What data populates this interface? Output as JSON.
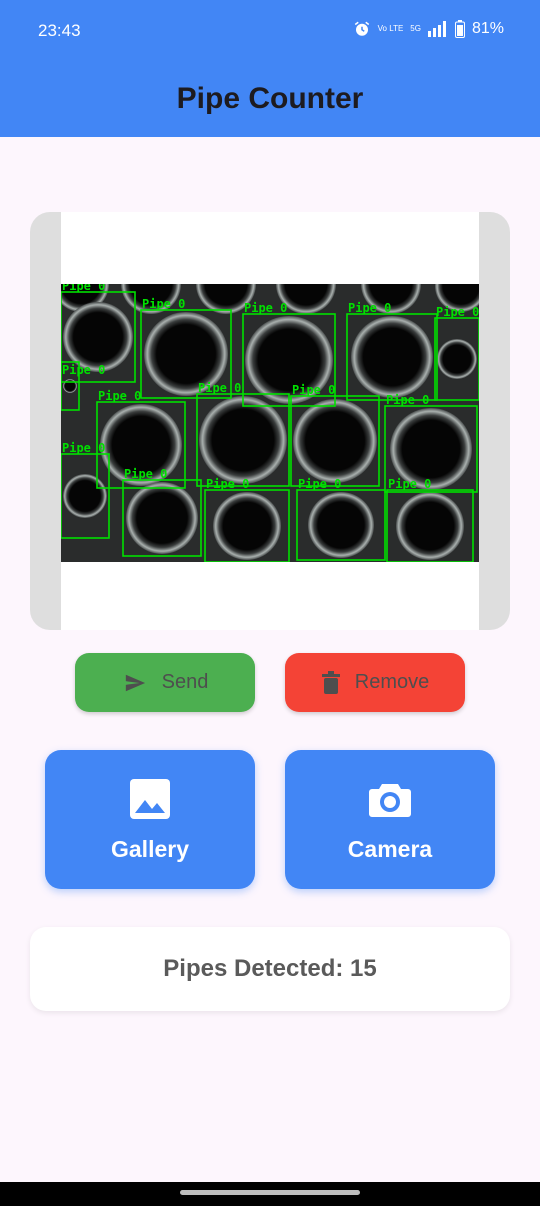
{
  "status_bar": {
    "time": "23:43",
    "signal_tags": [
      "Vo LTE",
      "5G"
    ],
    "battery": "81%"
  },
  "app_bar": {
    "title": "Pipe Counter"
  },
  "image": {
    "detection_label": "Pipe 0",
    "box_color": "#00e000"
  },
  "actions": {
    "send_label": "Send",
    "remove_label": "Remove",
    "gallery_label": "Gallery",
    "camera_label": "Camera"
  },
  "result": {
    "text": "Pipes Detected: 15"
  },
  "colors": {
    "primary": "#4286f5",
    "send": "#4caf50",
    "remove": "#f44336",
    "background": "#fdf6fd"
  }
}
